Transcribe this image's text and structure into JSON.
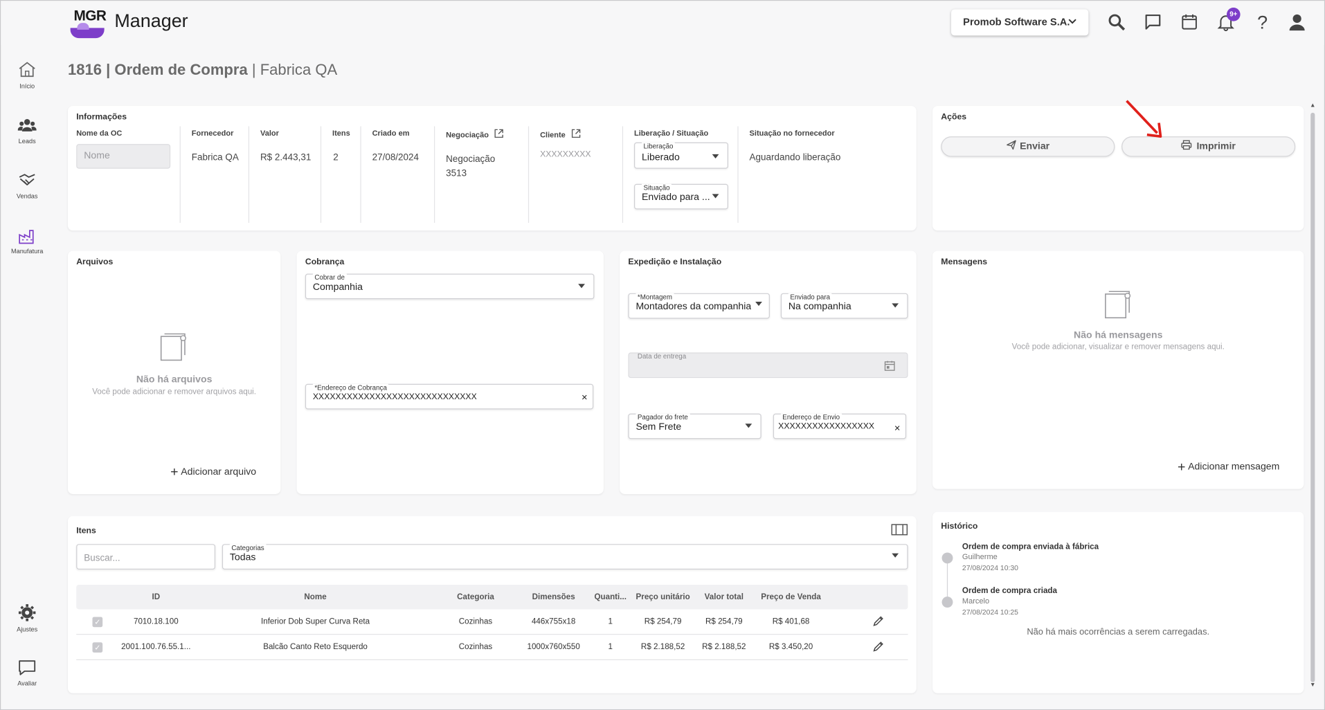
{
  "app": {
    "logo_text": "MGR",
    "title": "Manager"
  },
  "header": {
    "company": "Promob Software S.A.",
    "notifications_badge": "9+"
  },
  "nav": [
    {
      "label": "Início",
      "icon": "home-icon"
    },
    {
      "label": "Leads",
      "icon": "people-icon"
    },
    {
      "label": "Vendas",
      "icon": "handshake-icon"
    },
    {
      "label": "Manufatura",
      "icon": "factory-icon"
    },
    {
      "label": "Ajustes",
      "icon": "gear-icon"
    },
    {
      "label": "Avaliar",
      "icon": "feedback-icon"
    }
  ],
  "page": {
    "title_bold": "1816 | Ordem de Compra",
    "title_rest": " | Fabrica QA"
  },
  "info": {
    "section": "Informações",
    "labels": {
      "nome_oc": "Nome da OC",
      "fornecedor": "Fornecedor",
      "valor": "Valor",
      "itens": "Itens",
      "criado_em": "Criado em",
      "negociacao": "Negociação",
      "cliente": "Cliente",
      "liberacao_situacao": "Liberação / Situação",
      "situacao_fornecedor": "Situação no fornecedor"
    },
    "nome_placeholder": "Nome",
    "fornecedor": "Fabrica QA",
    "valor": "R$ 2.443,31",
    "itens": "2",
    "criado_em": "27/08/2024",
    "negociacao_line1": "Negociação",
    "negociacao_line2": "3513",
    "cliente": "XXXXXXXXX",
    "liberacao_label": "Liberação",
    "liberacao_value": "Liberado",
    "situacao_label": "Situação",
    "situacao_value": "Enviado para ...",
    "situacao_fornecedor": "Aguardando liberação"
  },
  "actions": {
    "section": "Ações",
    "send": "Enviar",
    "print": "Imprimir"
  },
  "files": {
    "section": "Arquivos",
    "empty_title": "Não há arquivos",
    "empty_sub": "Você pode adicionar e remover arquivos aqui.",
    "add": "Adicionar arquivo"
  },
  "billing": {
    "section": "Cobrança",
    "cobrar_de_label": "Cobrar de",
    "cobrar_de_value": "Companhia",
    "endereco_label": "*Endereço de Cobrança",
    "endereco_value": "XXXXXXXXXXXXXXXXXXXXXXXXXXXXX"
  },
  "shipping": {
    "section": "Expedição e Instalação",
    "montagem_label": "*Montagem",
    "montagem_value": "Montadores da companhia",
    "enviado_label": "Enviado para",
    "enviado_value": "Na companhia",
    "data_label": "Data de entrega",
    "pagador_label": "Pagador do frete",
    "pagador_value": "Sem Frete",
    "endereco_envio_label": "Endereço de Envio",
    "endereco_envio_value": "XXXXXXXXXXXXXXXXX"
  },
  "messages": {
    "section": "Mensagens",
    "empty_title": "Não há mensagens",
    "empty_sub": "Você pode adicionar, visualizar e remover mensagens aqui.",
    "add": "Adicionar mensagem"
  },
  "items": {
    "section": "Itens",
    "search_placeholder": "Buscar...",
    "categorias_label": "Categorias",
    "categorias_value": "Todas",
    "columns": [
      "ID",
      "Nome",
      "Categoria",
      "Dimensões",
      "Quanti...",
      "Preço unitário",
      "Valor total",
      "Preço de Venda"
    ],
    "rows": [
      [
        "7010.18.100",
        "Inferior Dob Super Curva Reta",
        "Cozinhas",
        "446x755x18",
        "1",
        "R$ 254,79",
        "R$ 254,79",
        "R$ 401,68"
      ],
      [
        "2001.100.76.55.1...",
        "Balcão Canto Reto Esquerdo",
        "Cozinhas",
        "1000x760x550",
        "1",
        "R$ 2.188,52",
        "R$ 2.188,52",
        "R$ 3.450,20"
      ]
    ]
  },
  "history": {
    "section": "Histórico",
    "events": [
      {
        "title": "Ordem de compra enviada à fábrica",
        "user": "Guilherme",
        "date": "27/08/2024 10:30"
      },
      {
        "title": "Ordem de compra criada",
        "user": "Marcelo",
        "date": "27/08/2024 10:25"
      }
    ],
    "footer": "Não há mais ocorrências a serem carregadas."
  },
  "colors": {
    "accent": "#7d3ec9",
    "annotation_arrow": "#e0201b"
  }
}
